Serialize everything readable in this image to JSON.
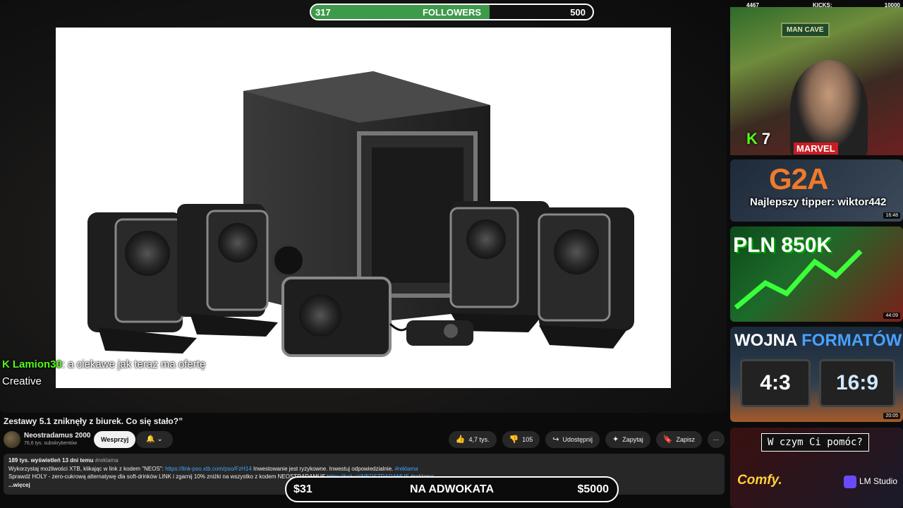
{
  "overlay": {
    "followers": {
      "current": "317",
      "label": "FOLLOWERS",
      "goal": "500",
      "progress": 0.634
    },
    "kicks": {
      "left": "4467",
      "label": "KICKS:",
      "goal": "10000"
    },
    "kick_count": "7",
    "top_tipper": "Najlepszy tipper: wiktor442",
    "donation": {
      "current": "$31",
      "label": "NA ADWOKATA",
      "goal": "$5000"
    }
  },
  "chat": {
    "user": "Lamion30",
    "message": ": a ciekawe jak teraz ma ofertę Creative"
  },
  "video": {
    "title": "Zestawy 5.1 zniknęły z biurek. Co się stało?”",
    "channel": "Neostradamus 2000",
    "subscribers": "76,6 tys. subskrybentów",
    "support_label": "Wesprzyj",
    "likes": "4,7 tys.",
    "dislikes": "105",
    "share_label": "Udostępnij",
    "ask_label": "Zapytaj",
    "save_label": "Zapisz"
  },
  "description": {
    "stats": "189 tys. wyświetleń  13 dni temu",
    "tag": "#reklama",
    "line1": "Wykorzystaj możliwości XTB, klikając w link z kodem \"NEOS\": ",
    "link1": "https://link-pso.xtb.com/pso/FzH14",
    "line1b": " Inwestowanie jest ryzykowne. Inwestuj odpowiedzialnie. ",
    "line2": "Sprawdź HOLY - zero-cukrową alternatywę dla soft-drinków LINK i zgarnij 10% zniżki na wszystko z kodem NEOSTRADAMUS ",
    "link2": "https://holy.pl/NEOSTRADAMUS",
    "more": "...więcej"
  },
  "sidebar": {
    "cam_sign": "MAN CAVE",
    "cam_brand": "MARVEL",
    "thumb1_brand": "G2A",
    "thumb1_duration": "16:48",
    "thumb2_title": "PLN 850K",
    "thumb2_duration": "44:09",
    "thumb3_title_a": "WOJNA",
    "thumb3_title_b": "FORMATÓW",
    "thumb3_left": "4:3",
    "thumb3_right": "16:9",
    "thumb3_duration": "20:05",
    "thumb4_assistant": "W czym Ci pomóc?",
    "thumb4_comfy": "Comfy.",
    "thumb4_lm": "LM Studio"
  },
  "colors": {
    "kick_green": "#53fc18",
    "follower_fill": "#3d9a4a",
    "link_blue": "#3ea6ff"
  }
}
